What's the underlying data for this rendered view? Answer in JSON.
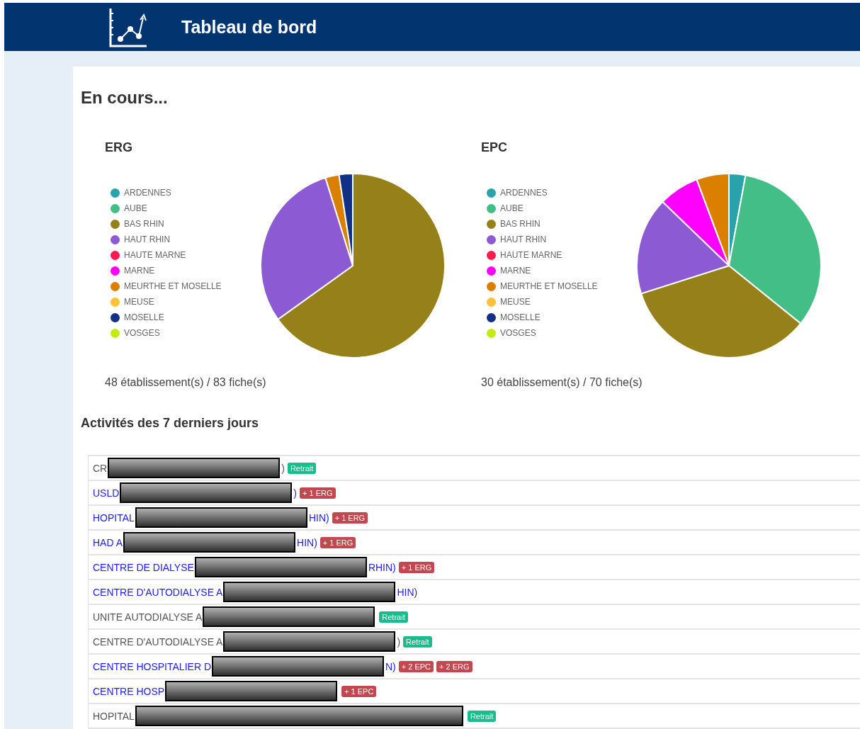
{
  "header": {
    "title": "Tableau de bord"
  },
  "section_title": "En cours...",
  "charts": [
    {
      "chart_data": {
        "type": "pie",
        "title": "ERG",
        "categories": [
          "ARDENNES",
          "AUBE",
          "BAS RHIN",
          "HAUT RHIN",
          "HAUTE MARNE",
          "MARNE",
          "MEURTHE ET MOSELLE",
          "MEUSE",
          "MOSELLE",
          "VOSGES"
        ],
        "values": [
          0,
          0,
          65.1,
          30.1,
          0,
          0,
          2.4,
          0,
          2.4,
          0
        ],
        "legend": "left",
        "colors": [
          "#2aa2a9",
          "#42be86",
          "#958019",
          "#8c5bd4",
          "#ff1a4f",
          "#ff00ff",
          "#db7f00",
          "#ffc03a",
          "#123185",
          "#c4ea12"
        ]
      },
      "caption": "48 établissement(s) / 83 fiche(s)"
    },
    {
      "chart_data": {
        "type": "pie",
        "title": "EPC",
        "categories": [
          "ARDENNES",
          "AUBE",
          "BAS RHIN",
          "HAUT RHIN",
          "HAUTE MARNE",
          "MARNE",
          "MEURTHE ET MOSELLE",
          "MEUSE",
          "MOSELLE",
          "VOSGES"
        ],
        "values": [
          2.9,
          32.9,
          34.3,
          17.1,
          0,
          7.1,
          5.7,
          0,
          0,
          0
        ],
        "legend": "left",
        "colors": [
          "#2aa2a9",
          "#42be86",
          "#958019",
          "#8c5bd4",
          "#ff1a4f",
          "#ff00ff",
          "#db7f00",
          "#ffc03a",
          "#123185",
          "#c4ea12"
        ]
      },
      "caption": "30 établissement(s) / 70 fiche(s)"
    }
  ],
  "activity_title": "Activités des 7 derniers jours",
  "rows": [
    {
      "prefix": "CR",
      "suffix": ")",
      "link": false,
      "tags": [
        {
          "text": "Retrait",
          "color": "#1abc8c"
        }
      ]
    },
    {
      "prefix": "USLD",
      "suffix": ")",
      "link": true,
      "tags": [
        {
          "text": "+ 1 ERG",
          "color": "#c0484e"
        }
      ]
    },
    {
      "prefix": "HOPITAL",
      "suffix": "HIN)",
      "link": true,
      "tags": [
        {
          "text": "+ 1 ERG",
          "color": "#c0484e"
        }
      ]
    },
    {
      "prefix": "HAD A",
      "suffix": "HIN)",
      "link": true,
      "tags": [
        {
          "text": "+ 1 ERG",
          "color": "#c0484e"
        }
      ]
    },
    {
      "prefix": "CENTRE DE DIALYSE",
      "suffix": "RHIN)",
      "link": true,
      "tags": [
        {
          "text": "+ 1 ERG",
          "color": "#c0484e"
        }
      ]
    },
    {
      "prefix": "CENTRE D'AUTODIALYSE A",
      "suffix": "HIN)",
      "link": true,
      "tags": []
    },
    {
      "prefix": "UNITE AUTODIALYSE A",
      "suffix": "",
      "link": false,
      "tags": [
        {
          "text": "Retrait",
          "color": "#1abc8c"
        }
      ]
    },
    {
      "prefix": "CENTRE D'AUTODIALYSE A",
      "suffix": ")",
      "link": false,
      "tags": [
        {
          "text": "Retrait",
          "color": "#1abc8c"
        }
      ]
    },
    {
      "prefix": "CENTRE HOSPITALIER D",
      "suffix": "N)",
      "link": true,
      "tags": [
        {
          "text": "+ 2 EPC",
          "color": "#c0484e"
        },
        {
          "text": "+ 2 ERG",
          "color": "#c0484e"
        }
      ]
    },
    {
      "prefix": "CENTRE HOSP",
      "suffix": "",
      "link": true,
      "tags": [
        {
          "text": "+ 1 EPC",
          "color": "#c0484e"
        }
      ]
    },
    {
      "prefix": "HOPITAL",
      "suffix": "",
      "link": false,
      "tags": [
        {
          "text": "Retrait",
          "color": "#1abc8c"
        }
      ]
    }
  ]
}
